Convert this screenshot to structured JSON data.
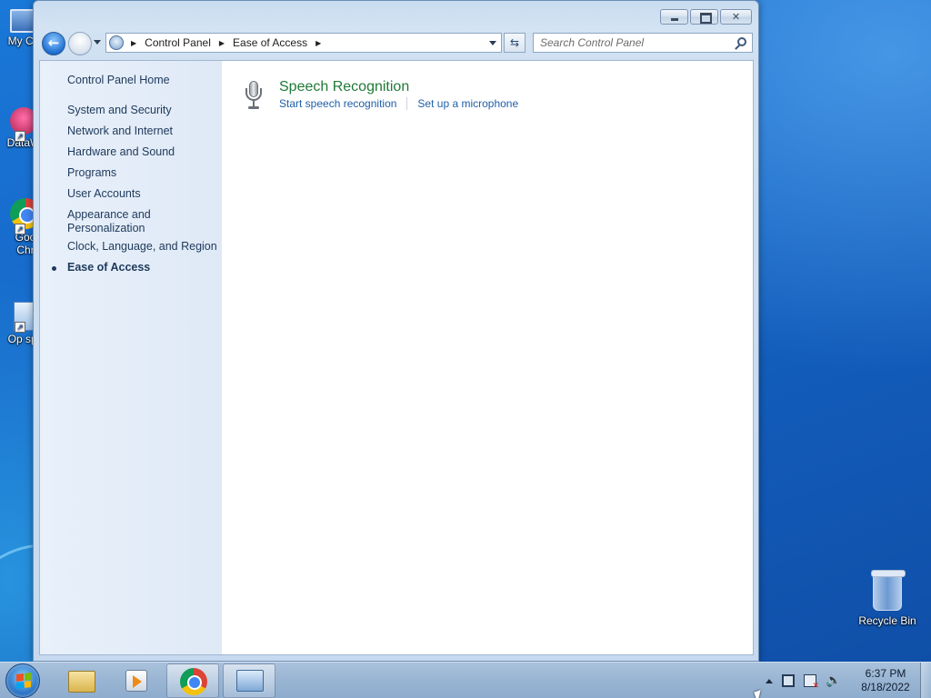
{
  "desktop": {
    "icons": [
      {
        "label": "My Co"
      },
      {
        "label": "DataW"
      },
      {
        "label": "Goo Chr"
      },
      {
        "label": "Op spp"
      }
    ],
    "recycle_bin": "Recycle Bin"
  },
  "window": {
    "address": {
      "crumbs": [
        "Control Panel",
        "Ease of Access"
      ]
    },
    "search": {
      "placeholder": "Search Control Panel"
    },
    "left_pane": {
      "home": "Control Panel Home",
      "items": [
        "System and Security",
        "Network and Internet",
        "Hardware and Sound",
        "Programs",
        "User Accounts",
        "Appearance and Personalization",
        "Clock, Language, and Region",
        "Ease of Access"
      ],
      "current": "Ease of Access"
    },
    "content": {
      "category_title": "Speech Recognition",
      "links": [
        "Start speech recognition",
        "Set up a microphone"
      ]
    }
  },
  "taskbar": {
    "clock": {
      "time": "6:37 PM",
      "date": "8/18/2022"
    }
  }
}
